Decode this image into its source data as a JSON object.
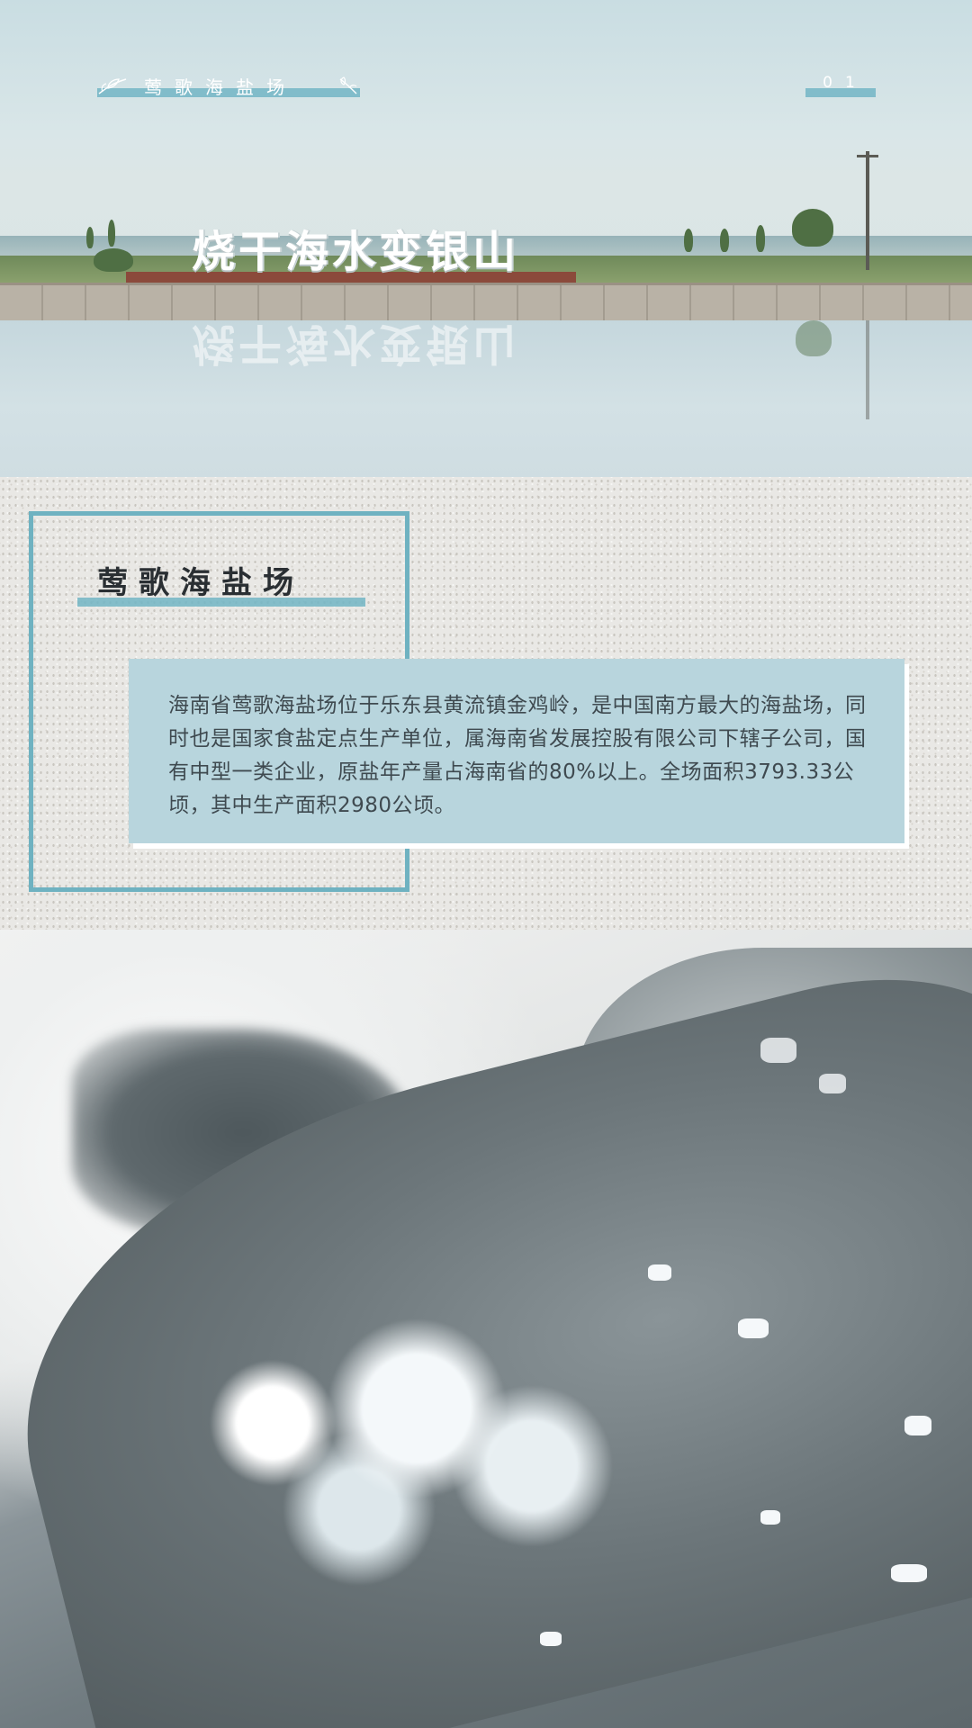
{
  "header": {
    "tab_title": "莺歌海盐场",
    "page_number": "01",
    "tab_icon_left": "leaf-branch-icon",
    "tab_icon_right": "leaf-branch-icon"
  },
  "hero": {
    "sign_text": "烧干海水变银山",
    "sign_reflection": "烧干海水变银山"
  },
  "intro": {
    "title": "莺歌海盐场",
    "paragraph": "海南省莺歌海盐场位于乐东县黄流镇金鸡岭，是中国南方最大的海盐场，同时也是国家食盐定点生产单位，属海南省发展控股有限公司下辖子公司，国有中型一类企业，原盐年产量占海南省的80%以上。全场面积3793.33公顷，其中生产面积2980公顷。"
  },
  "colors": {
    "accent": "#6fb2c1",
    "card_background": "#b8d5dd",
    "text": "#3f4a50",
    "paper": "#e9e8e5"
  }
}
